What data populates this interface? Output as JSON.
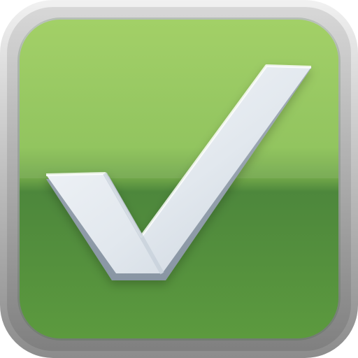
{
  "app_icon": {
    "icon_name": "checkmark-icon",
    "colors": {
      "frame_outer": "#e1e1e1",
      "frame_mid": "#b7b7b7",
      "frame_inner": "#8f8f8f",
      "green_top": "#9bcc5b",
      "green_mid": "#78b04a",
      "green_bottom": "#4f893d",
      "check_fill": "#e3e9ef",
      "check_shadow": "#a9b4c0",
      "check_edge": "#f7f9fb"
    }
  }
}
